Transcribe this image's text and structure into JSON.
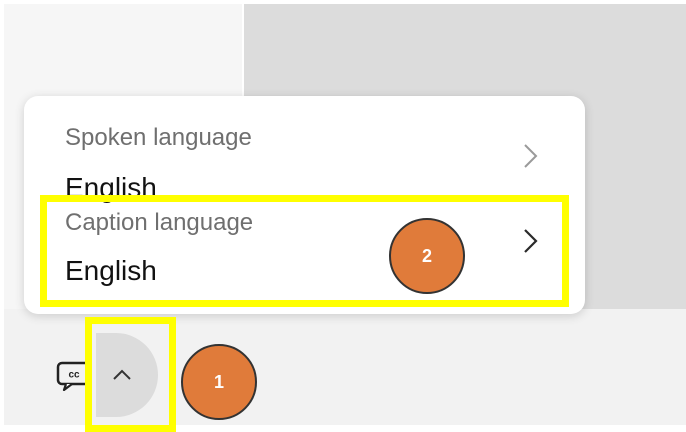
{
  "caption_menu": {
    "items": [
      {
        "label": "Spoken language",
        "value": "English"
      },
      {
        "label": "Caption language",
        "value": "English"
      }
    ]
  },
  "toolbar": {
    "cc_icon": "closed-captions-icon",
    "expand_icon": "chevron-up-icon"
  },
  "annotations": {
    "step_1": "1",
    "step_2": "2",
    "highlight_color": "#ffff00",
    "badge_color": "#e07b3a"
  }
}
